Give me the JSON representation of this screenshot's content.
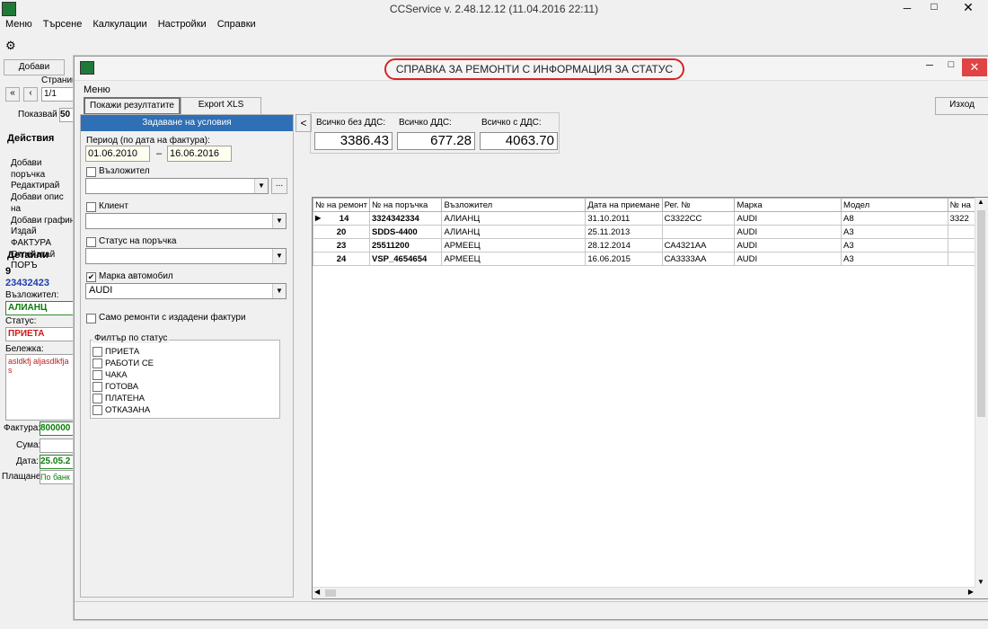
{
  "app": {
    "title": "CCService v. 2.48.12.12 (11.04.2016 22:11)",
    "menu": [
      "Меню",
      "Търсене",
      "Калкулации",
      "Настройки",
      "Справки"
    ]
  },
  "background": {
    "add_tab": "Добави",
    "page_label": "Страниц",
    "page_value": "1/1",
    "show_label": "Показвай",
    "show_value": "50",
    "actions_header": "Действия",
    "actions": [
      "Добави поръчка",
      "Редактирай",
      "Добави опис на",
      "Добави графин",
      "Издай ФАКТУРА",
      "Отпечатай ПОРЪ"
    ],
    "details_header": "Детайли",
    "detail_num": "9",
    "detail_order": "23432423",
    "insurer_label": "Възложител:",
    "insurer_value": "АЛИАНЦ",
    "status_label": "Статус:",
    "status_value": "ПРИЕТА",
    "note_label": "Бележка:",
    "note_value": "asldkfj aljasdlkfja s",
    "invoice_label": "Фактура:",
    "invoice_value": "800000",
    "sum_label": "Сума:",
    "date_label": "Дата:",
    "date_value": "25.05.2",
    "payment_label": "Плащане:",
    "payment_value": "По банк"
  },
  "dialog": {
    "title": "СПРАВКА ЗА РЕМОНТИ С ИНФОРМАЦИЯ ЗА СТАТУС",
    "menu": "Меню",
    "show_results": "Покажи резултатите",
    "export": "Export XLS",
    "exit": "Изход",
    "conditions": {
      "header": "Задаване на условия",
      "period_label": "Период (по дата на фактура):",
      "date_from": "01.06.2010",
      "date_to": "16.06.2016",
      "dash": "–",
      "insurer_label": "Възложител",
      "client_label": "Клиент",
      "order_status_label": "Статус на поръчка",
      "brand_label": "Марка автомобил",
      "brand_value": "AUDI",
      "only_invoiced_label": "Само ремонти с издадени фактури",
      "status_filter_label": "Филтър по статус",
      "statuses": [
        "ПРИЕТА",
        "РАБОТИ СЕ",
        "ЧАКА",
        "ГОТОВА",
        "ПЛАТЕНА",
        "ОТКАЗАНА"
      ],
      "collapse": "<"
    },
    "totals": {
      "no_vat_label": "Всичко без ДДС:",
      "no_vat_value": "3386.43",
      "vat_label": "Всичко ДДС:",
      "vat_value": "677.28",
      "with_vat_label": "Всичко с ДДС:",
      "with_vat_value": "4063.70"
    },
    "grid": {
      "columns": [
        "№ на ремонт",
        "№ на поръчка",
        "Възложител",
        "Дата на приемане",
        "Рег. №",
        "Марка",
        "Модел",
        "№ на"
      ],
      "rows": [
        [
          "14",
          "3324342334",
          "АЛИАНЦ",
          "31.10.2011",
          "С3322СС",
          "AUDI",
          "A8",
          "3322"
        ],
        [
          "20",
          "SDDS-4400",
          "АЛИАНЦ",
          "25.11.2013",
          "",
          "AUDI",
          "A3",
          ""
        ],
        [
          "23",
          "25511200",
          "АРМЕЕЦ",
          "28.12.2014",
          "СА4321АА",
          "AUDI",
          "A3",
          ""
        ],
        [
          "24",
          "VSP_4654654",
          "АРМЕЕЦ",
          "16.06.2015",
          "СА3333АА",
          "AUDI",
          "A3",
          ""
        ]
      ]
    }
  }
}
